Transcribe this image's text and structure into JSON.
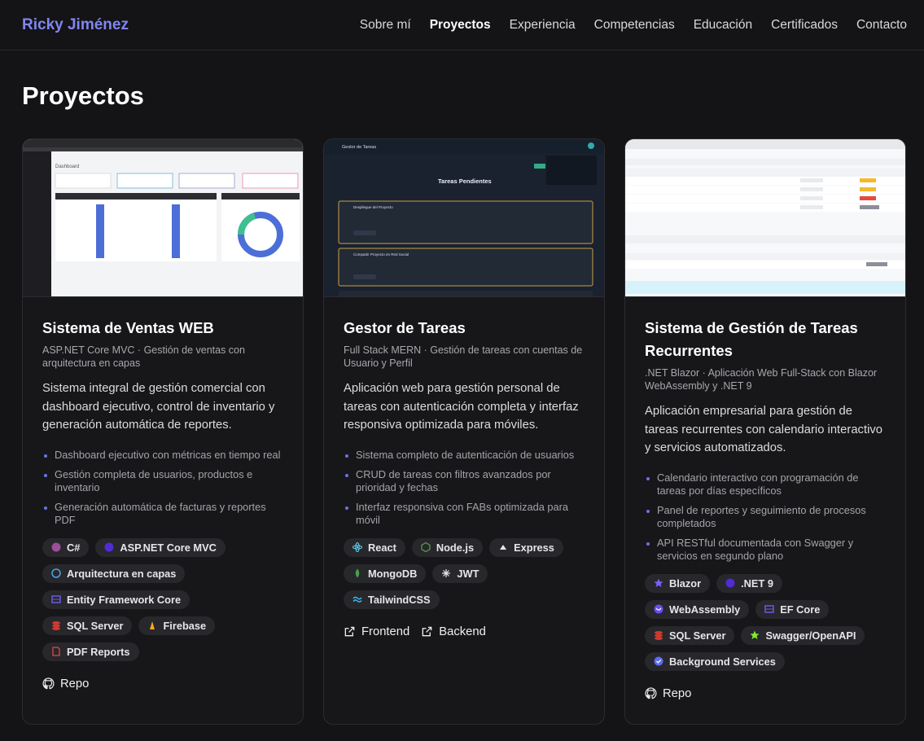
{
  "nav": {
    "brand": "Ricky Jiménez",
    "links": [
      "Sobre mí",
      "Proyectos",
      "Experiencia",
      "Competencias",
      "Educación",
      "Certificados",
      "Contacto"
    ]
  },
  "page": {
    "title": "Proyectos"
  },
  "projects": [
    {
      "title": "Sistema de Ventas WEB",
      "subtitle": "ASP.NET Core MVC · Gestión de ventas con arquitectura en capas",
      "description": "Sistema integral de gestión comercial con dashboard ejecutivo, control de inventario y generación automática de reportes.",
      "features": [
        "Dashboard ejecutivo con métricas en tiempo real",
        "Gestión completa de usuarios, productos e inventario",
        "Generación automática de facturas y reportes PDF"
      ],
      "tags": [
        {
          "label": "C#",
          "icon": "csharp-icon",
          "color": "#9b4f96"
        },
        {
          "label": "ASP.NET Core MVC",
          "icon": "dotnet-icon",
          "color": "#512bd4"
        },
        {
          "label": "Arquitectura en capas",
          "icon": "circle-icon",
          "color": "#4fa3e0"
        },
        {
          "label": "Entity Framework Core",
          "icon": "database-icon",
          "color": "#6b5bd6"
        },
        {
          "label": "SQL Server",
          "icon": "sql-server-icon",
          "color": "#cc3b2d"
        },
        {
          "label": "Firebase",
          "icon": "firebase-icon",
          "color": "#f5a623"
        },
        {
          "label": "PDF Reports",
          "icon": "pdf-icon",
          "color": "#e0483e"
        }
      ],
      "links": [
        {
          "label": "Repo",
          "icon": "github-icon"
        }
      ],
      "thumb": {
        "app_title": "Dashboard"
      }
    },
    {
      "title": "Gestor de Tareas",
      "subtitle": "Full Stack MERN · Gestión de tareas con cuentas de Usuario y Perfil",
      "description": "Aplicación web para gestión personal de tareas con autenticación completa y interfaz responsiva optimizada para móviles.",
      "features": [
        "Sistema completo de autenticación de usuarios",
        "CRUD de tareas con filtros avanzados por prioridad y fechas",
        "Interfaz responsiva con FABs optimizada para móvil"
      ],
      "tags": [
        {
          "label": "React",
          "icon": "react-icon",
          "color": "#61dafb"
        },
        {
          "label": "Node.js",
          "icon": "nodejs-icon",
          "color": "#5fa04e"
        },
        {
          "label": "Express",
          "icon": "express-icon",
          "color": "#e6e6ea"
        },
        {
          "label": "MongoDB",
          "icon": "mongodb-icon",
          "color": "#47a248"
        },
        {
          "label": "JWT",
          "icon": "jwt-icon",
          "color": "#e6e6ea"
        },
        {
          "label": "TailwindCSS",
          "icon": "tailwind-icon",
          "color": "#38bdf8"
        }
      ],
      "links": [
        {
          "label": "Frontend",
          "icon": "external-link-icon"
        },
        {
          "label": "Backend",
          "icon": "external-link-icon"
        }
      ],
      "thumb": {
        "app_title": "Gestor de Tareas",
        "heading": "Tareas Pendientes",
        "task1": "Despliegue del Proyecto",
        "task2": "Compartir Proyecto en Red Social"
      }
    },
    {
      "title": "Sistema de Gestión de Tareas Recurrentes",
      "subtitle": ".NET Blazor · Aplicación Web Full-Stack con Blazor WebAssembly y .NET 9",
      "description": "Aplicación empresarial para gestión de tareas recurrentes con calendario interactivo y servicios automatizados.",
      "features": [
        "Calendario interactivo con programación de tareas por días específicos",
        "Panel de reportes y seguimiento de procesos completados",
        "API RESTful documentada con Swagger y servicios en segundo plano"
      ],
      "tags": [
        {
          "label": "Blazor",
          "icon": "blazor-icon",
          "color": "#7b61ff"
        },
        {
          "label": ".NET 9",
          "icon": "dotnet-icon",
          "color": "#512bd4"
        },
        {
          "label": "WebAssembly",
          "icon": "webassembly-icon",
          "color": "#654ff0"
        },
        {
          "label": "EF Core",
          "icon": "database-icon",
          "color": "#6b5bd6"
        },
        {
          "label": "SQL Server",
          "icon": "sql-server-icon",
          "color": "#cc3b2d"
        },
        {
          "label": "Swagger/OpenAPI",
          "icon": "swagger-icon",
          "color": "#85ea2d"
        },
        {
          "label": "Background Services",
          "icon": "check-circle-icon",
          "color": "#5b6cf0"
        }
      ],
      "links": [
        {
          "label": "Repo",
          "icon": "github-icon"
        }
      ],
      "thumb": {}
    }
  ]
}
